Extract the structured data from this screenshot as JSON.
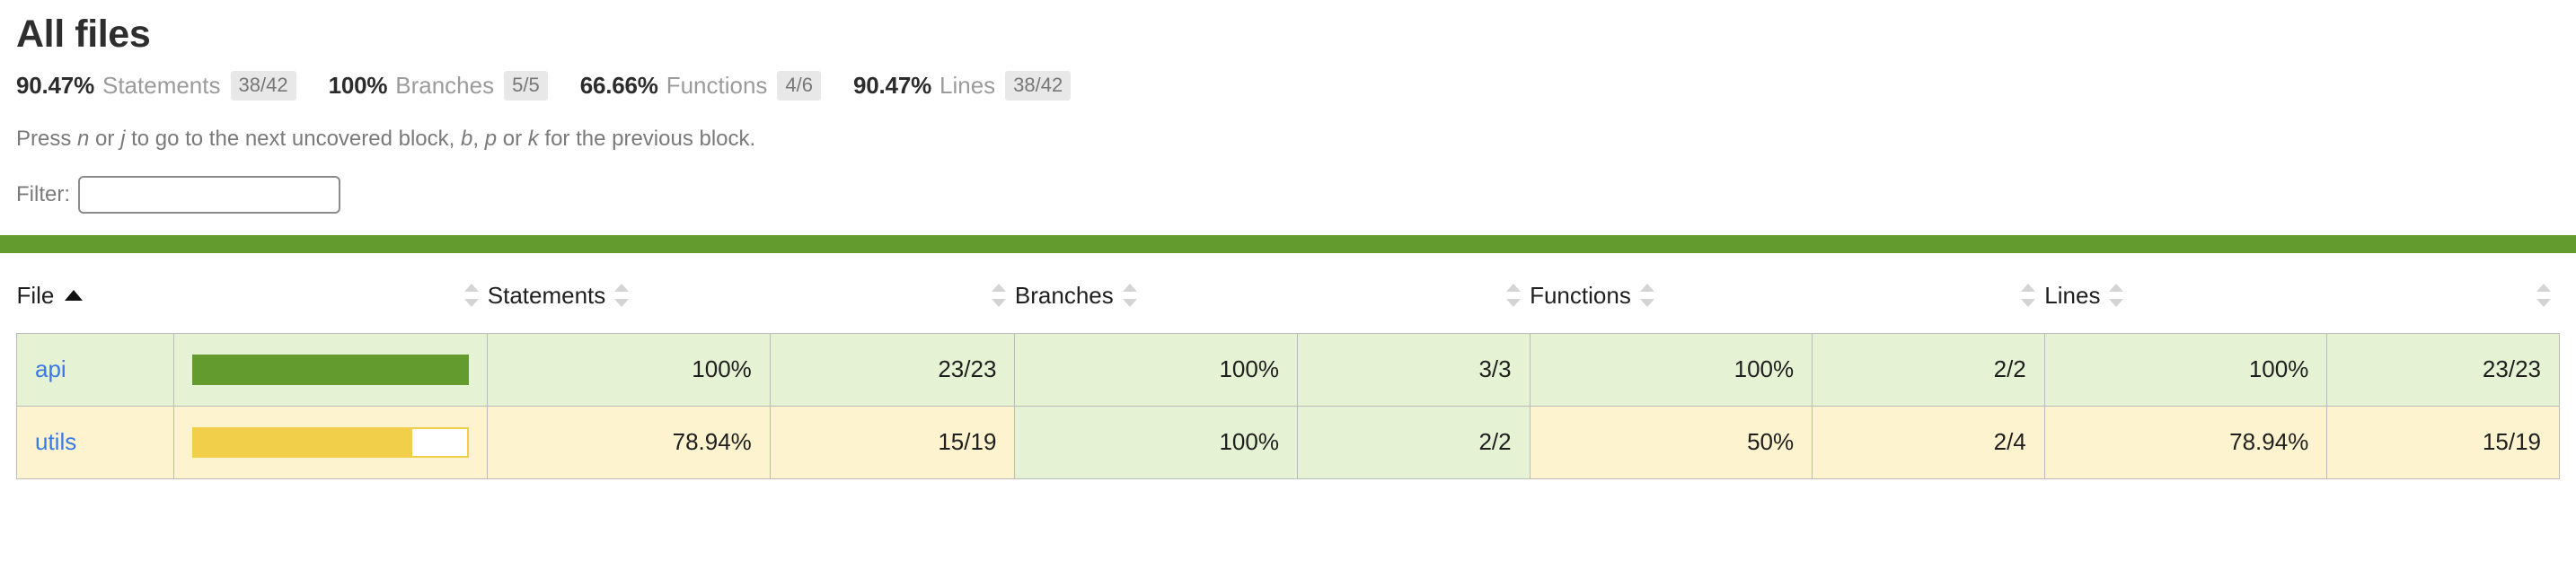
{
  "page": {
    "title": "All files"
  },
  "summary": {
    "metrics": [
      {
        "pct": "90.47%",
        "label": "Statements",
        "fraction": "38/42"
      },
      {
        "pct": "100%",
        "label": "Branches",
        "fraction": "5/5"
      },
      {
        "pct": "66.66%",
        "label": "Functions",
        "fraction": "4/6"
      },
      {
        "pct": "90.47%",
        "label": "Lines",
        "fraction": "38/42"
      }
    ]
  },
  "help": {
    "part1": "Press ",
    "key1": "n",
    "part2": " or ",
    "key2": "j",
    "part3": " to go to the next uncovered block, ",
    "key3": "b",
    "part4": ", ",
    "key4": "p",
    "part5": " or ",
    "key5": "k",
    "part6": " for the previous block."
  },
  "filter": {
    "label": "Filter:",
    "value": "",
    "placeholder": ""
  },
  "status_bar": {
    "level": "high",
    "color": "#639b2e"
  },
  "table": {
    "columns": [
      {
        "key": "file",
        "label": "File",
        "sorted": "asc"
      },
      {
        "key": "pic",
        "label": "",
        "sorted": "none"
      },
      {
        "key": "statements",
        "label": "Statements",
        "sorted": "none"
      },
      {
        "key": "branches",
        "label": "Branches",
        "sorted": "none"
      },
      {
        "key": "functions",
        "label": "Functions",
        "sorted": "none"
      },
      {
        "key": "lines",
        "label": "Lines",
        "sorted": "none"
      }
    ],
    "rows": [
      {
        "file": "api",
        "row_level": "high",
        "bar": {
          "level": "high",
          "pct": 100
        },
        "statements": {
          "pct": "100%",
          "abs": "23/23",
          "level": "high"
        },
        "branches": {
          "pct": "100%",
          "abs": "3/3",
          "level": "high"
        },
        "functions": {
          "pct": "100%",
          "abs": "2/2",
          "level": "high"
        },
        "lines": {
          "pct": "100%",
          "abs": "23/23",
          "level": "high"
        }
      },
      {
        "file": "utils",
        "row_level": "medium",
        "bar": {
          "level": "medium",
          "pct": 78.94
        },
        "statements": {
          "pct": "78.94%",
          "abs": "15/19",
          "level": "medium"
        },
        "branches": {
          "pct": "100%",
          "abs": "2/2",
          "level": "high"
        },
        "functions": {
          "pct": "50%",
          "abs": "2/4",
          "level": "medium"
        },
        "lines": {
          "pct": "78.94%",
          "abs": "15/19",
          "level": "medium"
        }
      }
    ]
  },
  "colors": {
    "high_bg": "#e5f2d3",
    "medium_bg": "#fdf3cf",
    "high_bar": "#639b2e",
    "medium_bar": "#f2cf4a",
    "link": "#3b78e7",
    "muted_text": "#9b9b9b",
    "border": "#bbbbbb"
  }
}
